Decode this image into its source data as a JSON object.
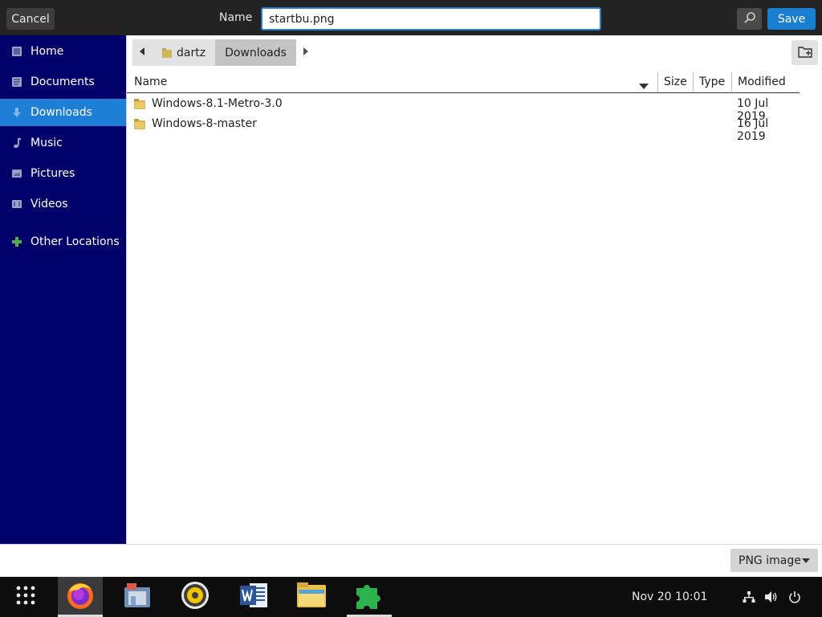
{
  "header": {
    "cancel_label": "Cancel",
    "name_label": "Name",
    "filename_value": "startbu.png",
    "save_label": "Save"
  },
  "sidebar": {
    "items": [
      {
        "label": "Home",
        "icon": "home-icon"
      },
      {
        "label": "Documents",
        "icon": "documents-icon"
      },
      {
        "label": "Downloads",
        "icon": "downloads-icon",
        "active": true
      },
      {
        "label": "Music",
        "icon": "music-icon"
      },
      {
        "label": "Pictures",
        "icon": "pictures-icon"
      },
      {
        "label": "Videos",
        "icon": "videos-icon"
      },
      {
        "label": "Other Locations",
        "icon": "plus-icon"
      }
    ]
  },
  "pathbar": {
    "segments": [
      "dartz",
      "Downloads"
    ],
    "current": "Downloads"
  },
  "columns": {
    "name": "Name",
    "size": "Size",
    "type": "Type",
    "modified": "Modified"
  },
  "files": [
    {
      "name": "Windows-8.1-Metro-3.0",
      "modified": "10 Jul 2019",
      "kind": "folder"
    },
    {
      "name": "Windows-8-master",
      "modified": "16 Jul 2019",
      "kind": "folder"
    }
  ],
  "filter": {
    "selected": "PNG image"
  },
  "taskbar": {
    "apps": [
      "app-grid",
      "firefox",
      "file-manager",
      "rhythmbox",
      "word",
      "file-explorer",
      "puzzle"
    ],
    "active_app": "firefox",
    "clock": "Nov 20  10:01"
  },
  "colors": {
    "sidebar_bg": "#00006b",
    "sidebar_active": "#1e7fd6",
    "save_button": "#1b7fd1",
    "header_bg": "#232323",
    "taskbar_bg": "#0d0d0d"
  }
}
